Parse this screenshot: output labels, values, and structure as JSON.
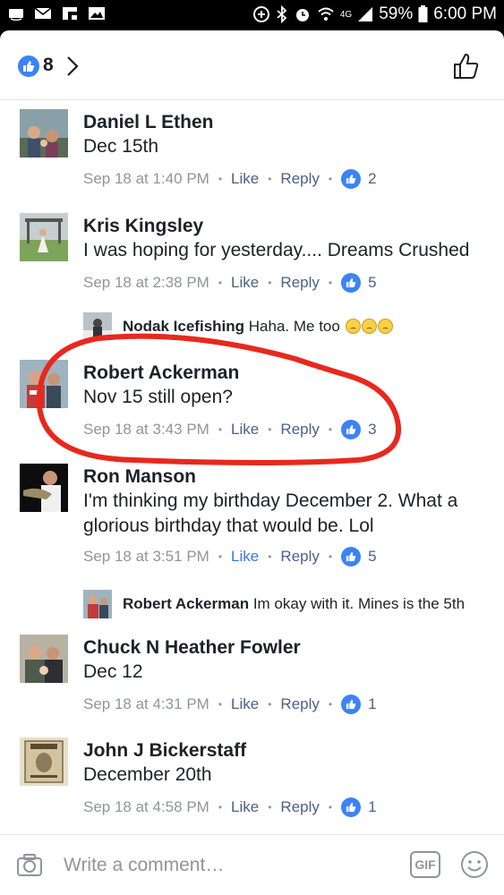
{
  "status_bar": {
    "network": "4G",
    "battery": "59%",
    "time": "6:00 PM"
  },
  "header": {
    "like_count": "8",
    "like_icon": "like-thumb-icon",
    "chevron_icon": "chevron-right-icon",
    "action_icon": "thumbs-up-outline-icon"
  },
  "comments": [
    {
      "name": "Daniel L Ethen",
      "text": "Dec 15th",
      "time": "Sep 18 at 1:40 PM",
      "like": "Like",
      "reply": "Reply",
      "reactions": "2",
      "liked": false
    },
    {
      "name": "Kris Kingsley",
      "text": "I was hoping for yesterday.... Dreams Crushed",
      "time": "Sep 18 at 2:38 PM",
      "like": "Like",
      "reply": "Reply",
      "reactions": "5",
      "liked": false
    },
    {
      "name": "Robert Ackerman",
      "text": "Nov 15 still open?",
      "time": "Sep 18 at 3:43 PM",
      "like": "Like",
      "reply": "Reply",
      "reactions": "3",
      "liked": false
    },
    {
      "name": "Ron Manson",
      "text": "I'm thinking my birthday December 2.  What a glorious birthday that would be. Lol",
      "time": "Sep 18 at 3:51 PM",
      "like": "Like",
      "reply": "Reply",
      "reactions": "5",
      "liked": true
    },
    {
      "name": "Chuck N Heather Fowler",
      "text": "Dec 12",
      "time": "Sep 18 at 4:31 PM",
      "like": "Like",
      "reply": "Reply",
      "reactions": "1",
      "liked": false
    },
    {
      "name": "John J Bickerstaff",
      "text": "December 20th",
      "time": "Sep 18 at 4:58 PM",
      "like": "Like",
      "reply": "Reply",
      "reactions": "1",
      "liked": false
    }
  ],
  "replies": [
    {
      "name": "Nodak Icefishing",
      "text": "Haha. Me too"
    },
    {
      "name": "Robert Ackerman",
      "text": "Im okay with it. Mines is the 5th"
    }
  ],
  "composer": {
    "placeholder": "Write a comment…",
    "gif_label": "GIF"
  },
  "colors": {
    "accent_blue": "#3b83f6",
    "link_blue": "#4b6089",
    "meta_gray": "#90949c",
    "highlight_red": "#e8281e"
  }
}
